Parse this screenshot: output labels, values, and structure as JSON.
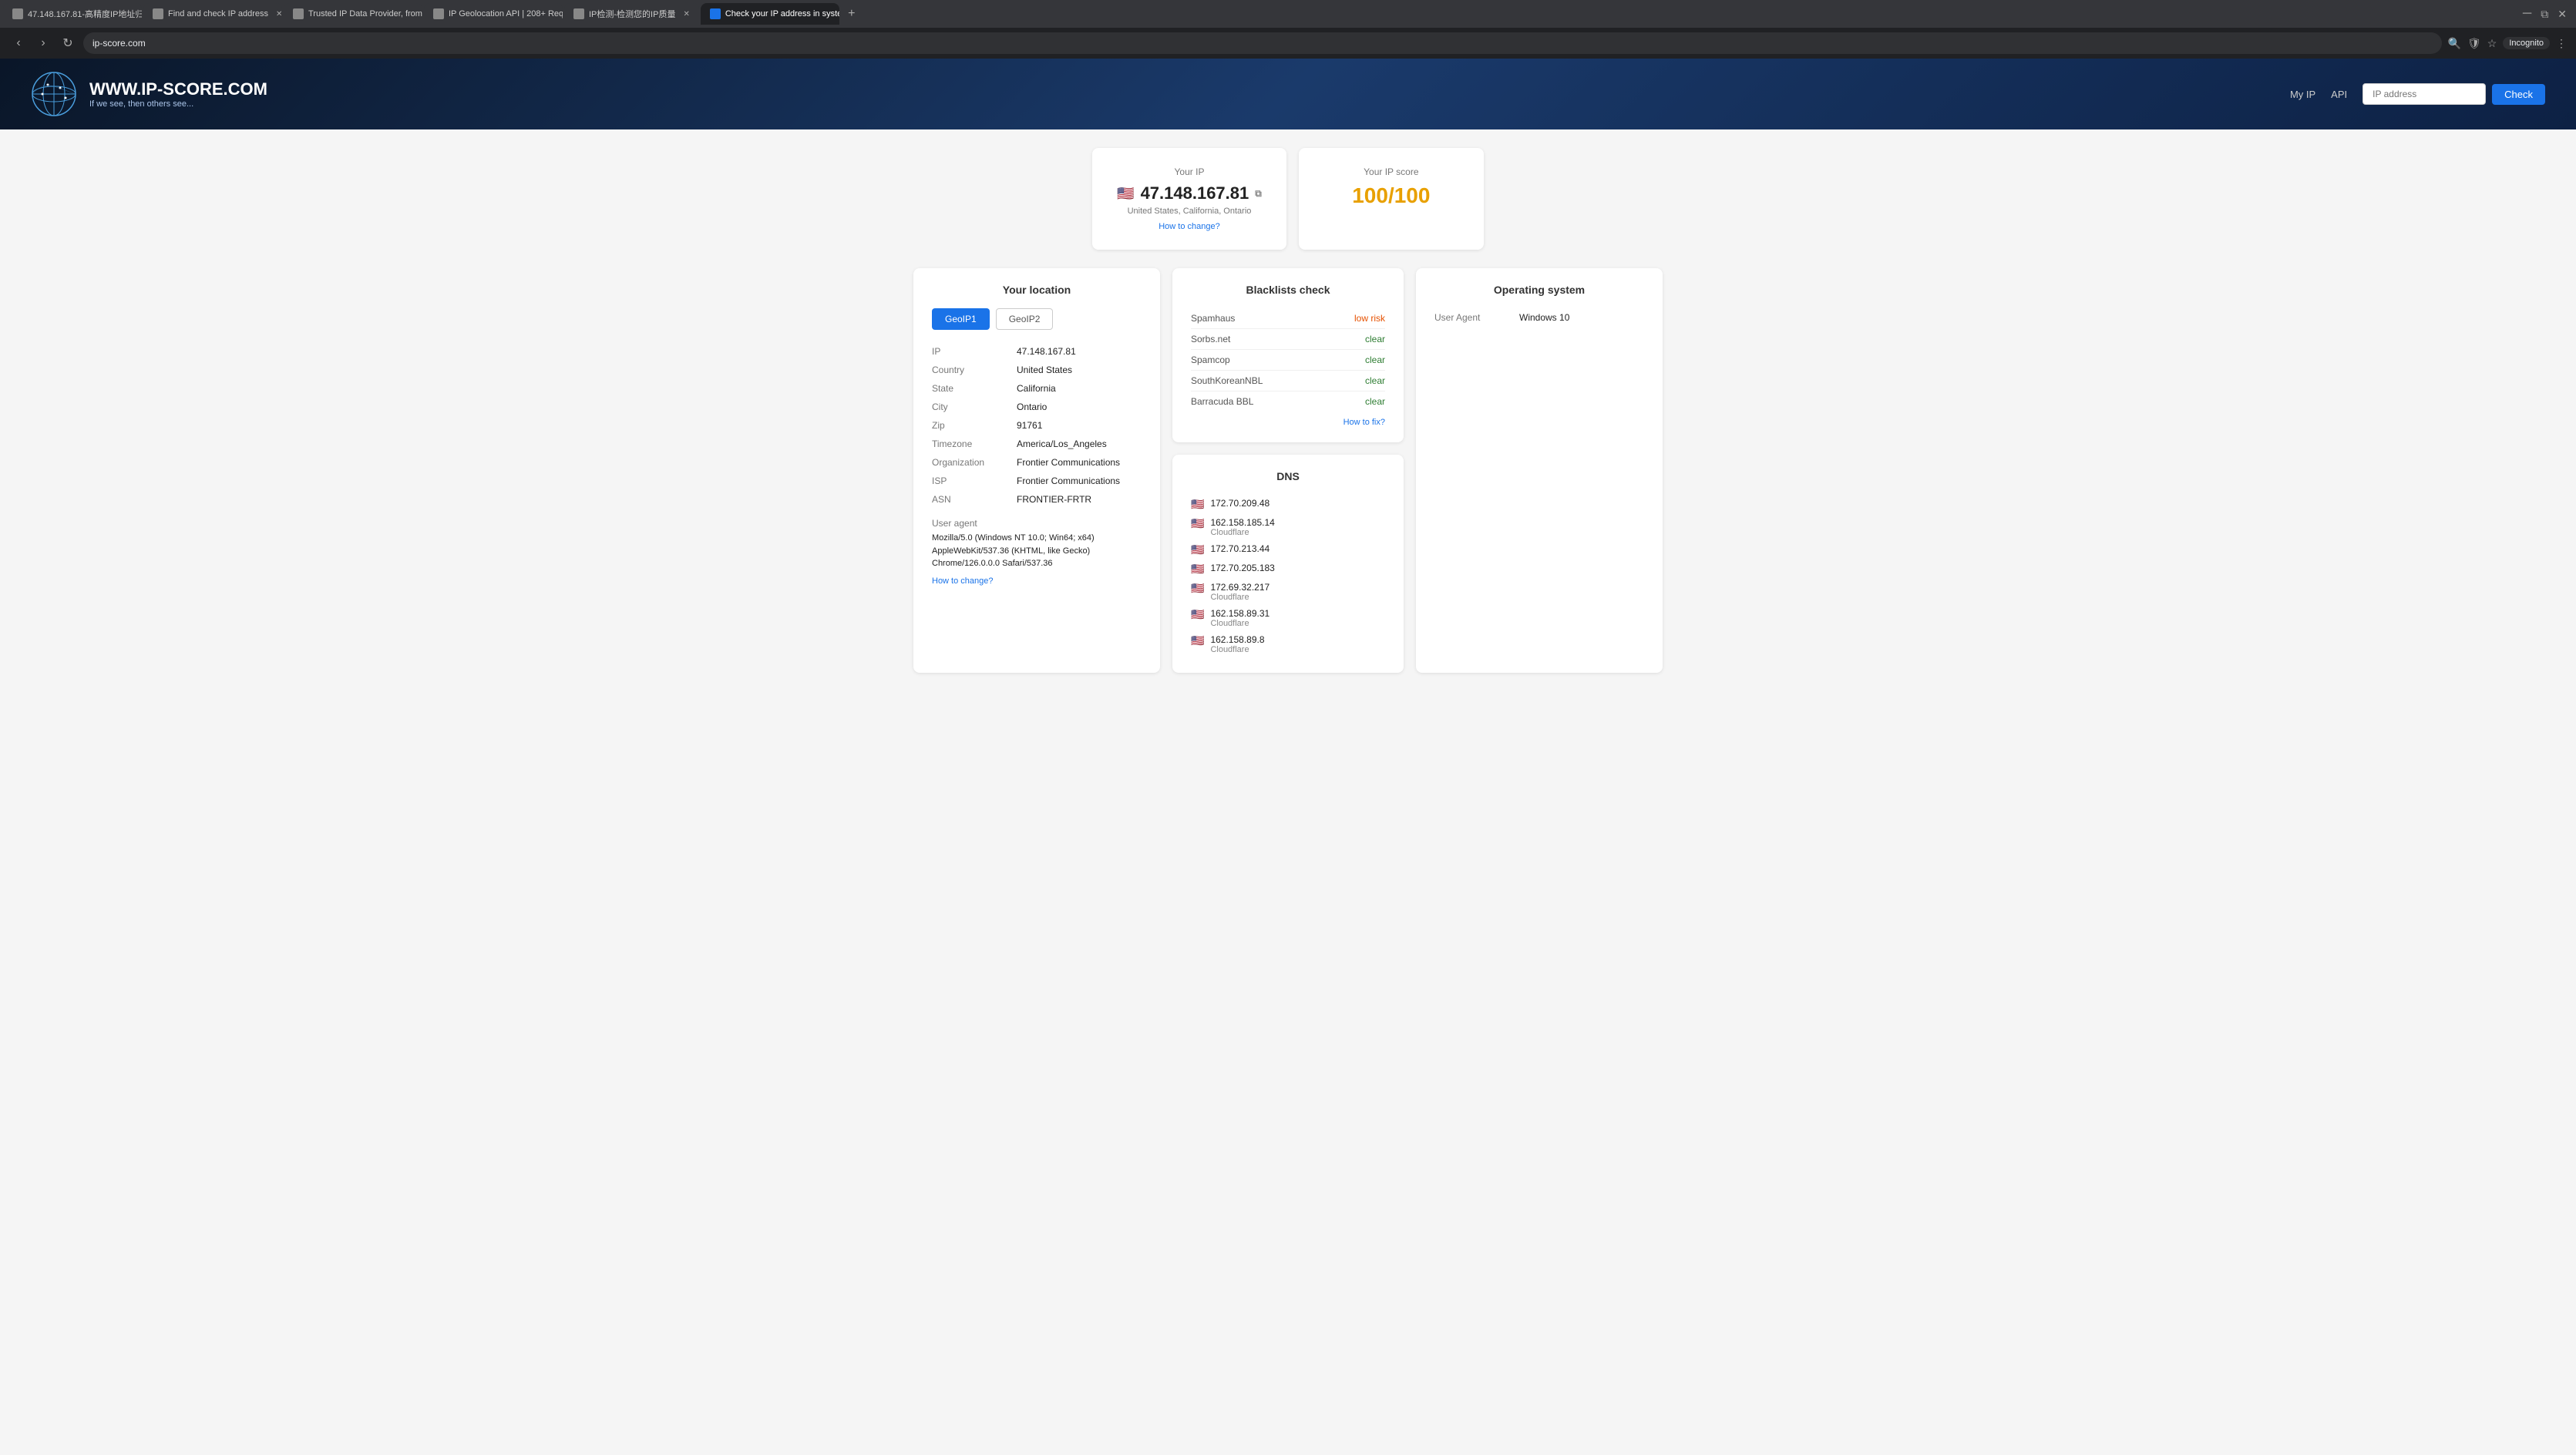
{
  "browser": {
    "tabs": [
      {
        "label": "47.148.167.81-高精度IP地址归...",
        "active": false,
        "icon": "page-icon"
      },
      {
        "label": "Find and check IP address",
        "active": false,
        "icon": "page-icon"
      },
      {
        "label": "Trusted IP Data Provider, from...",
        "active": false,
        "icon": "page-icon"
      },
      {
        "label": "IP Geolocation API | 208+ Requ...",
        "active": false,
        "icon": "page-icon"
      },
      {
        "label": "IP检测-检测您的IP质量",
        "active": false,
        "icon": "page-icon"
      },
      {
        "label": "Check your IP address in syste...",
        "active": true,
        "icon": "page-icon"
      }
    ],
    "url": "ip-score.com",
    "incognito_label": "Incognito"
  },
  "header": {
    "site_title": "WWW.IP-SCORE.COM",
    "site_subtitle": "If we see, then others see...",
    "nav_links": [
      "My IP",
      "API"
    ],
    "ip_input_placeholder": "IP address",
    "check_button": "Check"
  },
  "your_ip_card": {
    "label": "Your IP",
    "ip": "47.148.167.81",
    "flag": "🇺🇸",
    "location": "United States, California, Ontario",
    "how_to_link": "How to change?"
  },
  "your_score_card": {
    "label": "Your IP score",
    "score": "100/100"
  },
  "location_section": {
    "title": "Your location",
    "tab_geo1": "GeoIP1",
    "tab_geo2": "GeoIP2",
    "fields": [
      {
        "label": "IP",
        "value": "47.148.167.81"
      },
      {
        "label": "Country",
        "value": "United States"
      },
      {
        "label": "State",
        "value": "California"
      },
      {
        "label": "City",
        "value": "Ontario"
      },
      {
        "label": "Zip",
        "value": "91761"
      },
      {
        "label": "Timezone",
        "value": "America/Los_Angeles"
      },
      {
        "label": "Organization",
        "value": "Frontier Communications"
      },
      {
        "label": "ISP",
        "value": "Frontier Communications"
      },
      {
        "label": "ASN",
        "value": "FRONTIER-FRTR"
      }
    ],
    "user_agent_label": "User agent",
    "user_agent_value": "Mozilla/5.0 (Windows NT 10.0; Win64; x64) AppleWebKit/537.36 (KHTML, like Gecko) Chrome/126.0.0.0 Safari/537.36",
    "how_to_link": "How to change?"
  },
  "blacklist_section": {
    "title": "Blacklists check",
    "entries": [
      {
        "name": "Spamhaus",
        "status": "low risk",
        "type": "warning"
      },
      {
        "name": "Sorbs.net",
        "status": "clear",
        "type": "clear"
      },
      {
        "name": "Spamcop",
        "status": "clear",
        "type": "clear"
      },
      {
        "name": "SouthKoreanNBL",
        "status": "clear",
        "type": "clear"
      },
      {
        "name": "Barracuda BBL",
        "status": "clear",
        "type": "clear"
      }
    ],
    "how_to_fix": "How to fix?"
  },
  "dns_section": {
    "title": "DNS",
    "entries": [
      {
        "flag": "🇺🇸",
        "ip": "172.70.209.48",
        "provider": ""
      },
      {
        "flag": "🇺🇸",
        "ip": "162.158.185.14",
        "provider": "Cloudflare"
      },
      {
        "flag": "🇺🇸",
        "ip": "172.70.213.44",
        "provider": ""
      },
      {
        "flag": "🇺🇸",
        "ip": "172.70.205.183",
        "provider": ""
      },
      {
        "flag": "🇺🇸",
        "ip": "172.69.32.217",
        "provider": "Cloudflare"
      },
      {
        "flag": "🇺🇸",
        "ip": "162.158.89.31",
        "provider": "Cloudflare"
      },
      {
        "flag": "🇺🇸",
        "ip": "162.158.89.8",
        "provider": "Cloudflare"
      }
    ]
  },
  "os_section": {
    "title": "Operating system",
    "fields": [
      {
        "label": "User Agent",
        "value": "Windows 10"
      }
    ]
  }
}
